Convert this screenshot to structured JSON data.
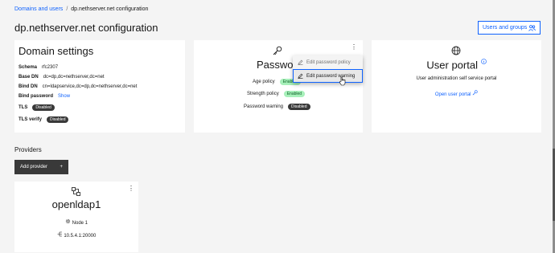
{
  "breadcrumb": {
    "link": "Domains and users",
    "separator": "/",
    "current": "dp.nethserver.net configuration"
  },
  "page_title": "dp.nethserver.net configuration",
  "top_button": {
    "label": "Users and groups",
    "icon": "users-icon"
  },
  "domain_settings": {
    "title": "Domain settings",
    "schema": {
      "label": "Schema",
      "value": "rfc2307"
    },
    "base_dn": {
      "label": "Base DN",
      "value": "dc=dp,dc=nethserver,dc=net"
    },
    "bind_dn": {
      "label": "Bind DN",
      "value": "cn=ldapservice,dc=dp,dc=nethserver,dc=net"
    },
    "bind_password": {
      "label": "Bind password",
      "value": "Show"
    },
    "tls": {
      "label": "TLS",
      "value": "Disabled"
    },
    "tls_verify": {
      "label": "TLS verify",
      "value": "Disabled"
    }
  },
  "password_card": {
    "title": "Passwo",
    "icon": "key-icon",
    "age_policy": {
      "label": "Age policy",
      "value": "Enabled"
    },
    "strength_policy": {
      "label": "Strength policy",
      "value": "Enabled"
    },
    "password_warning": {
      "label": "Password warning",
      "value": "Disabled"
    }
  },
  "overflow_menu": {
    "items": [
      {
        "label": "Edit password policy",
        "icon": "edit-icon"
      },
      {
        "label": "Edit password warning",
        "icon": "edit-icon"
      }
    ]
  },
  "portal_card": {
    "title": "User portal",
    "icon": "globe-icon",
    "description": "User administration self service portal",
    "link": "Open user portal"
  },
  "providers": {
    "heading": "Providers",
    "add_button": "Add provider",
    "items": [
      {
        "name": "openldap1",
        "node": "Node 1",
        "address": "10.5.4.1:20000"
      }
    ]
  },
  "colors": {
    "accent": "#0f62fe",
    "dark_tag": "#393939",
    "green_tag": "#a7f0ba"
  }
}
